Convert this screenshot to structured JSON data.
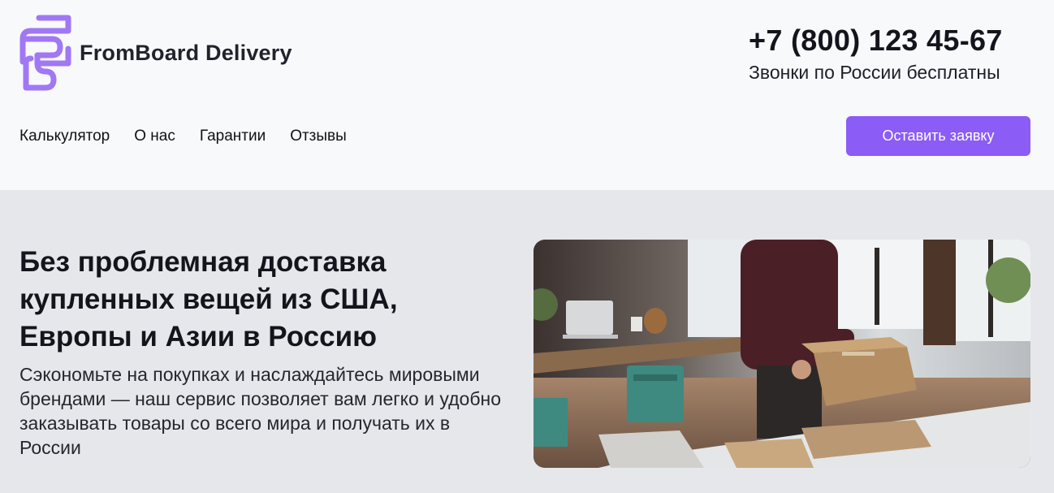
{
  "brand": {
    "name": "FromBoard Delivery",
    "logo_icon": "fb-logo-icon",
    "accent": "#8b5cf6"
  },
  "contact": {
    "phone": "+7 (800) 123 45-67",
    "note": "Звонки по России бесплатны"
  },
  "nav": {
    "items": [
      {
        "label": "Калькулятор"
      },
      {
        "label": "О нас"
      },
      {
        "label": "Гарантии"
      },
      {
        "label": "Отзывы"
      }
    ]
  },
  "header": {
    "cta_label": "Оставить заявку"
  },
  "hero": {
    "title": "Без проблемная доставка купленных вещей из США, Европы и Азии в Россию",
    "description": "Сэкономьте на покупках и наслаждайтесь мировыми брендами — наш сервис позволяет вам легко и удобно заказывать товары со всего мира и получать их в России",
    "image_subject": "person-packing-box-photo"
  }
}
